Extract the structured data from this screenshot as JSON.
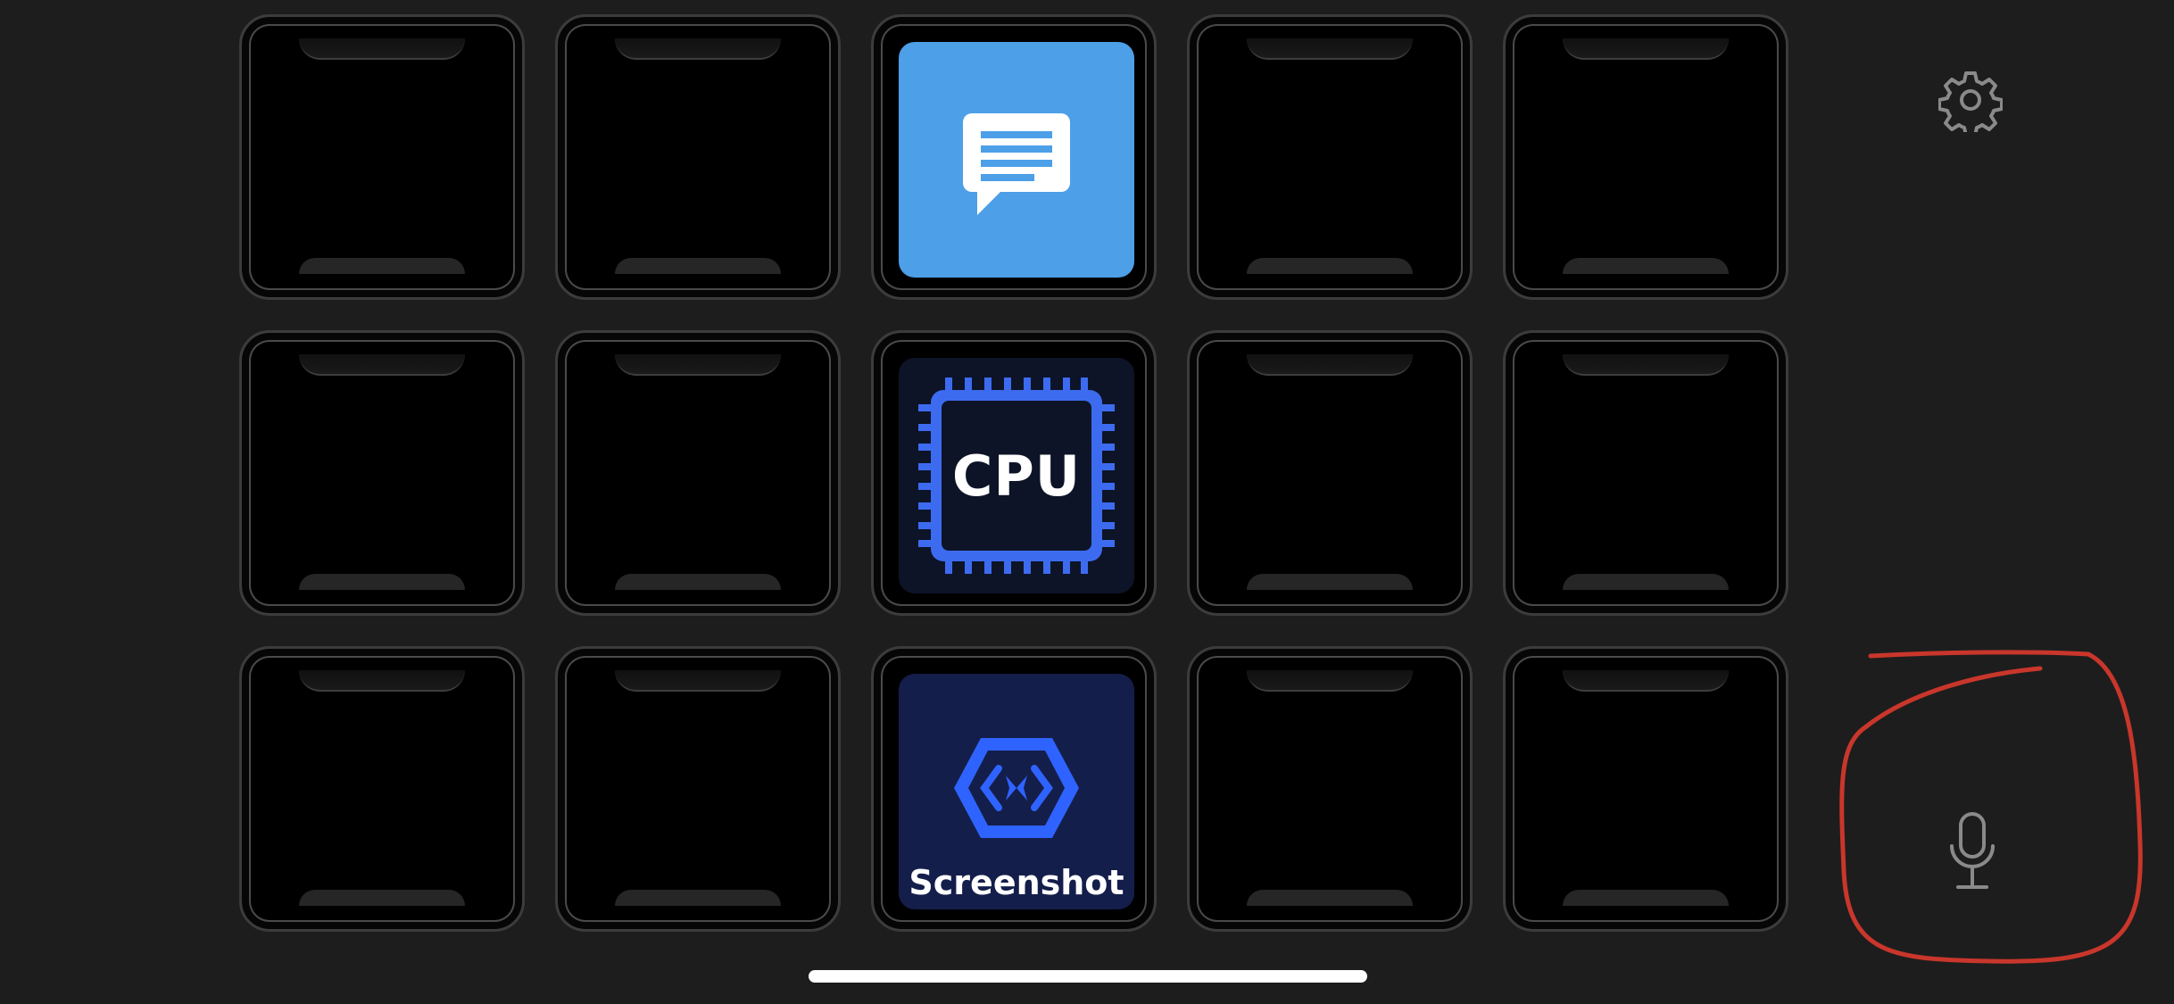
{
  "grid": {
    "rows": 3,
    "columns": 5,
    "buttons": [
      {
        "row": 1,
        "column": 3,
        "action": "text",
        "icon": "chat-bubble-icon"
      },
      {
        "row": 2,
        "column": 3,
        "action": "cpu",
        "label": "CPU",
        "icon": "cpu-chip-icon"
      },
      {
        "row": 3,
        "column": 3,
        "action": "screenshot",
        "label": "Screenshot",
        "icon": "screenshot-hexagon-icon"
      }
    ]
  },
  "sidebar": {
    "settings_icon": "gear-icon",
    "voice_icon": "microphone-icon"
  },
  "colors": {
    "background": "#1d1d1d",
    "chat_button": "#4d9fe8",
    "cpu_accent": "#3d6bf0",
    "screenshot_accent": "#2f63ff",
    "annotation": "#c9362b"
  }
}
